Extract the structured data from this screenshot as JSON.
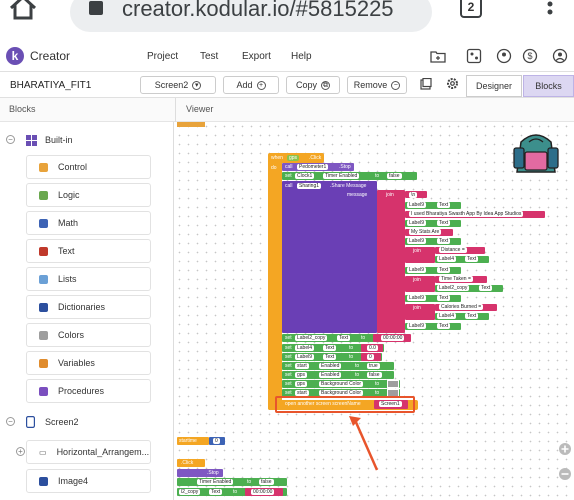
{
  "browser": {
    "url": "creator.kodular.io/#5815225",
    "tabs_count": "2"
  },
  "app": {
    "name": "Creator",
    "logo_letter": "k"
  },
  "menu": [
    "Project",
    "Test",
    "Export",
    "Help"
  ],
  "toolbar": {
    "project": "BHARATIYA_FIT1",
    "screen": "Screen2",
    "add": "Add",
    "copy": "Copy",
    "remove": "Remove",
    "designer": "Designer",
    "blocks": "Blocks"
  },
  "panels": {
    "blocks": "Blocks",
    "viewer": "Viewer"
  },
  "tree": {
    "builtin": "Built-in",
    "categories": [
      {
        "label": "Control",
        "color": "#e8a33b"
      },
      {
        "label": "Logic",
        "color": "#6aa84f"
      },
      {
        "label": "Math",
        "color": "#3d63b5"
      },
      {
        "label": "Text",
        "color": "#c0392b"
      },
      {
        "label": "Lists",
        "color": "#6ba0d6"
      },
      {
        "label": "Dictionaries",
        "color": "#2c4f9e"
      },
      {
        "label": "Colors",
        "color": "#9e9e9e"
      },
      {
        "label": "Variables",
        "color": "#e08c2d"
      },
      {
        "label": "Procedures",
        "color": "#7b4fbf"
      }
    ],
    "screen": "Screen2",
    "components": [
      "Horizontal_Arrangem...",
      "Image4"
    ]
  },
  "blocks": {
    "when": "when",
    "gps": "gps",
    "click": ".Click",
    "do": "do",
    "call": "call",
    "pedometer": "Pedometer1",
    "stop": ".Stop",
    "set": "set",
    "clock": "Clock1",
    "timer_enabled": "Timer Enabled",
    "to": "to",
    "false": "false",
    "sharing": "Sharing1",
    "share_message": ".Share Message",
    "message": "message",
    "join": "join",
    "newline": "\\n",
    "label9": "Label9",
    "text": "Text",
    "used_msg": "I used Bharatiya Swasth App By Idea App Studios",
    "my_stats": "My Stats Are",
    "distance": "Distance =",
    "label4": "Label4",
    "time_taken": "Time Taken =",
    "label2copy": "Label2_copy",
    "calories": "Calories Burned =",
    "label2copy_set": "Label2_copy",
    "time_zero": "00:00:00",
    "zero_val": "0.0",
    "zero": "0",
    "start": "start",
    "enabled": "Enabled",
    "true": "true",
    "bg_color": "Background Color",
    "open_screen": "open another screen  screenName",
    "screen1": "Screen1",
    "starttime": "startime",
    "zero2": "0",
    "click2": ".Click",
    "stop2": ".Stop",
    "timer_enabled2": "Timer Enabled",
    "label2copy2": "l2_copy",
    "time_zero2": "00:00:00"
  }
}
